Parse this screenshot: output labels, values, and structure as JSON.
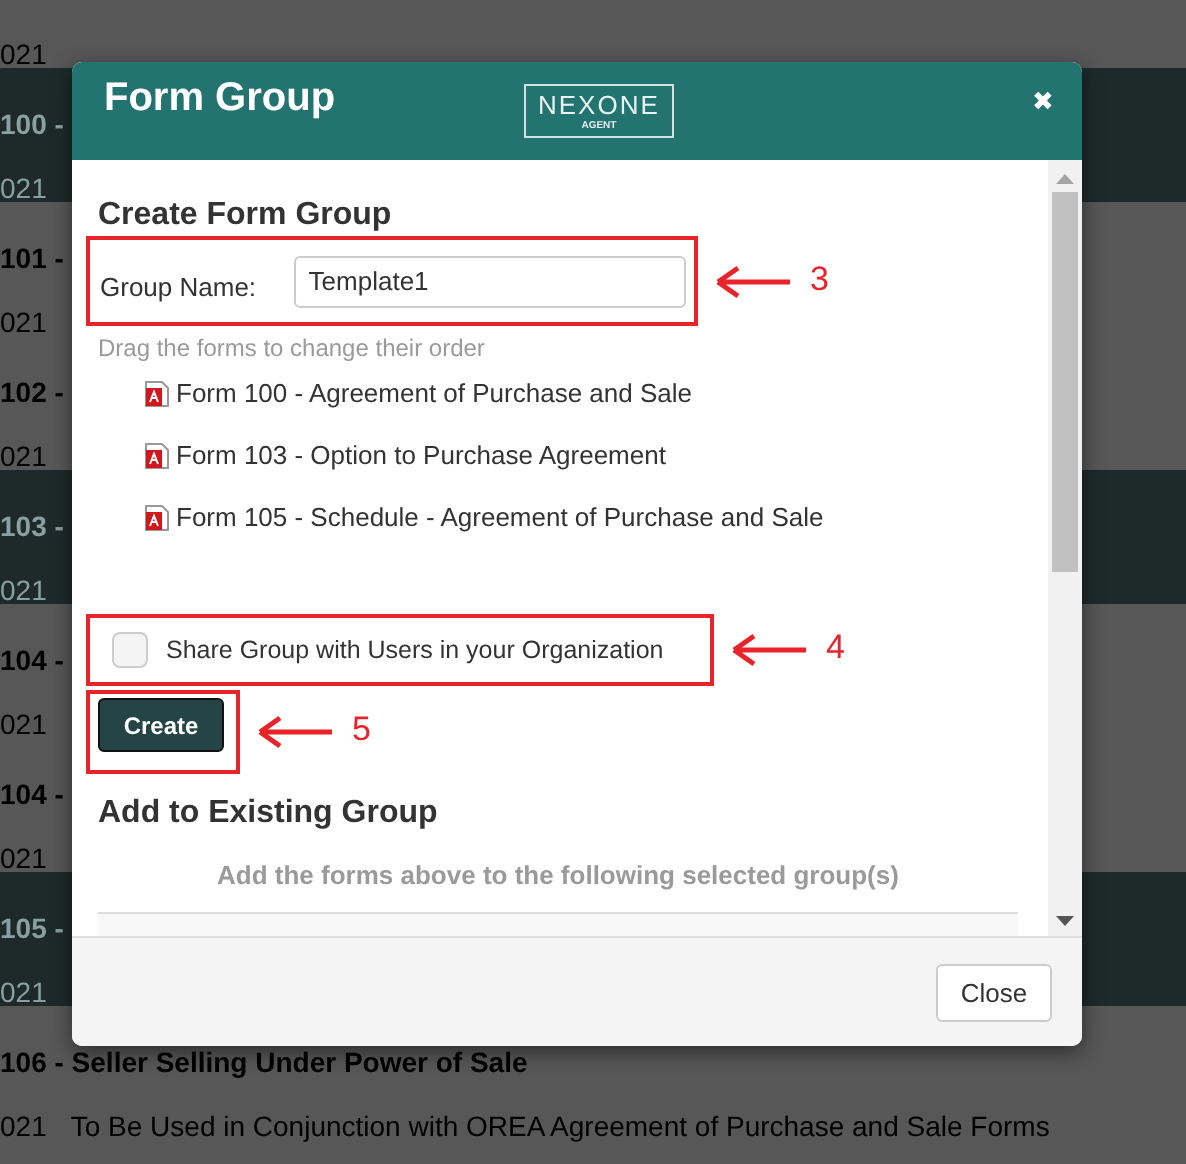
{
  "background_list": [
    {
      "date": "021",
      "selected": false
    },
    {
      "title": "100 -",
      "date": "021",
      "selected": true
    },
    {
      "title": "101 -",
      "date": "021",
      "selected": false
    },
    {
      "title": "102 -",
      "date": "021",
      "selected": false
    },
    {
      "title": "103 -",
      "date": "021",
      "selected": true
    },
    {
      "title": "104 -",
      "date": "021",
      "selected": false
    },
    {
      "title": "104 -",
      "date": "021",
      "selected": false
    },
    {
      "title": "105 -",
      "date": "021",
      "selected": true
    },
    {
      "title": "106 - Seller Selling Under Power of Sale",
      "date": "021",
      "description": "To Be Used in Conjunction with OREA Agreement of Purchase and Sale Forms",
      "selected": false
    }
  ],
  "dialog": {
    "title": "Form Group",
    "logo": {
      "name": "NEXONE",
      "tagline": "AGENT"
    },
    "close_icon": "✖",
    "create_section": {
      "heading": "Create Form Group",
      "group_name_label": "Group Name:",
      "group_name_value": "Template1",
      "hint": "Drag the forms to change their order",
      "forms": [
        "Form 100 - Agreement of Purchase and Sale",
        "Form 103 - Option to Purchase Agreement",
        "Form 105 - Schedule - Agreement of Purchase and Sale"
      ],
      "share": {
        "label": "Share Group with Users in your Organization",
        "checked": false
      },
      "create_button": "Create"
    },
    "existing_section": {
      "heading": "Add to Existing Group",
      "instruction": "Add the forms above to the following selected group(s)"
    },
    "footer_button": "Close"
  },
  "annotations": [
    {
      "label": "3"
    },
    {
      "label": "4"
    },
    {
      "label": "5"
    }
  ]
}
